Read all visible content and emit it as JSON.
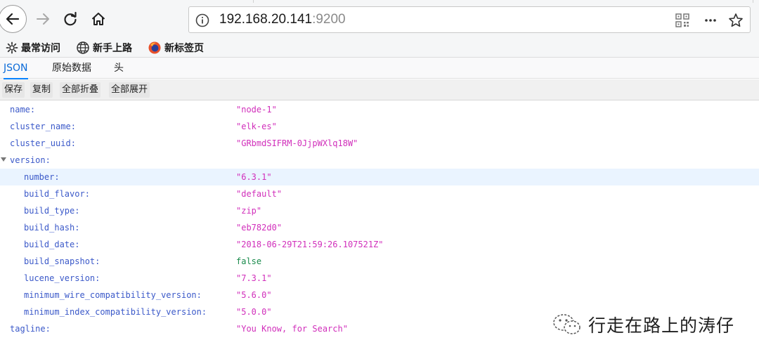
{
  "browser": {
    "url_host": "192.168.20.141",
    "url_port": ":9200"
  },
  "bookmarks": [
    {
      "label": "最常访问",
      "icon": "gear-icon"
    },
    {
      "label": "新手上路",
      "icon": "globe-icon"
    },
    {
      "label": "新标签页",
      "icon": "firefox-icon"
    }
  ],
  "viewer_tabs": [
    {
      "label": "JSON",
      "active": true
    },
    {
      "label": "原始数据",
      "active": false
    },
    {
      "label": "头",
      "active": false
    }
  ],
  "toolbar": {
    "save_label": "保存",
    "copy_label": "复制",
    "collapse_all_label": "全部折叠",
    "expand_all_label": "全部展开"
  },
  "json_rows": [
    {
      "key": "name:",
      "value": "\"node-1\"",
      "type": "string",
      "indent": 0
    },
    {
      "key": "cluster_name:",
      "value": "\"elk-es\"",
      "type": "string",
      "indent": 0
    },
    {
      "key": "cluster_uuid:",
      "value": "\"GRbmdSIFRM-0JjpWXlq18W\"",
      "type": "string",
      "indent": 0
    },
    {
      "key": "version:",
      "value": "",
      "type": "object",
      "indent": 0,
      "expanded": true
    },
    {
      "key": "number:",
      "value": "\"6.3.1\"",
      "type": "string",
      "indent": 1,
      "highlighted": true
    },
    {
      "key": "build_flavor:",
      "value": "\"default\"",
      "type": "string",
      "indent": 1
    },
    {
      "key": "build_type:",
      "value": "\"zip\"",
      "type": "string",
      "indent": 1
    },
    {
      "key": "build_hash:",
      "value": "\"eb782d0\"",
      "type": "string",
      "indent": 1
    },
    {
      "key": "build_date:",
      "value": "\"2018-06-29T21:59:26.107521Z\"",
      "type": "string",
      "indent": 1
    },
    {
      "key": "build_snapshot:",
      "value": "false",
      "type": "boolean",
      "indent": 1
    },
    {
      "key": "lucene_version:",
      "value": "\"7.3.1\"",
      "type": "string",
      "indent": 1
    },
    {
      "key": "minimum_wire_compatibility_version:",
      "value": "\"5.6.0\"",
      "type": "string",
      "indent": 1
    },
    {
      "key": "minimum_index_compatibility_version:",
      "value": "\"5.0.0\"",
      "type": "string",
      "indent": 1
    },
    {
      "key": "tagline:",
      "value": "\"You Know, for Search\"",
      "type": "string",
      "indent": 0
    }
  ],
  "watermark": {
    "text": "行走在路上的涛仔",
    "icon": "wechat-icon"
  },
  "colors": {
    "key": "#3b59c9",
    "string": "#d12fbb",
    "boolean": "#198a4b",
    "accent": "#0a84ff"
  }
}
